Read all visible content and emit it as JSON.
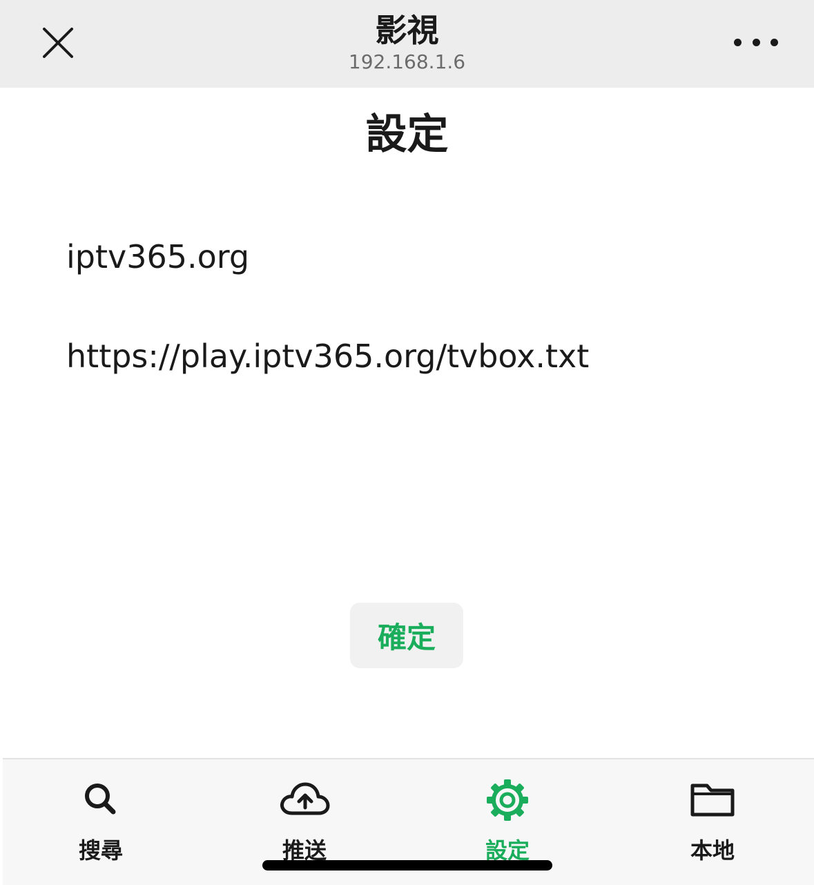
{
  "navbar": {
    "title": "影視",
    "subtitle": "192.168.1.6",
    "close_icon": "close-icon",
    "more_icon": "more-horizontal-icon"
  },
  "page": {
    "title": "設定"
  },
  "form": {
    "name_value": "iptv365.org",
    "url_value": "https://play.iptv365.org/tvbox.txt",
    "confirm_label": "確定"
  },
  "tabs": [
    {
      "label": "搜尋",
      "icon": "search-icon",
      "active": false
    },
    {
      "label": "推送",
      "icon": "cloud-upload-icon",
      "active": false
    },
    {
      "label": "設定",
      "icon": "gear-icon",
      "active": true
    },
    {
      "label": "本地",
      "icon": "folder-icon",
      "active": false
    }
  ],
  "colors": {
    "accent": "#1aad5b",
    "navbar_bg": "#ededed",
    "text": "#1a1a1a"
  }
}
